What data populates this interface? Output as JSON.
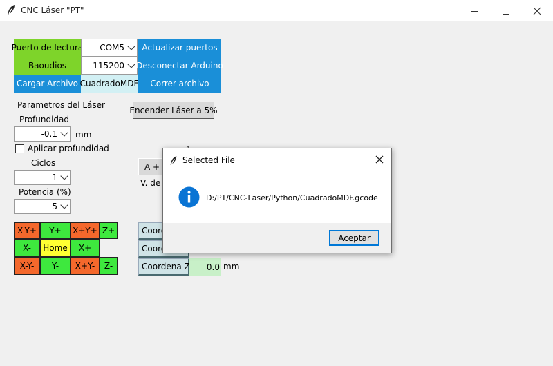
{
  "window": {
    "title": "CNC Láser \"PT\""
  },
  "connection": {
    "port_label": "Puerto de lectura",
    "port_value": "COM5",
    "refresh_ports": "Actualizar puertos",
    "baud_label": "Baoudios",
    "baud_value": "115200",
    "disconnect": "Desconectar Arduino",
    "load_file": "Cargar Archivo",
    "file_name": "CuadradoMDF",
    "run_file": "Correr archivo"
  },
  "laser": {
    "params_heading": "Parametros del Láser",
    "depth_label": "Profundidad",
    "depth_value": "-0.1",
    "depth_unit": "mm",
    "apply_depth_label": "Aplicar profundidad",
    "apply_depth_checked": false,
    "cycles_label": "Ciclos",
    "cycles_value": "1",
    "power_label": "Potencia (%)",
    "power_value": "5",
    "turn_on_button": "Encender Láser a 5%"
  },
  "partial": {
    "a_plus": "A +",
    "v_label": "V. de A",
    "a_heading": "A"
  },
  "jog": {
    "x_minus_y_plus": "X-Y+",
    "y_plus": "Y+",
    "x_plus_y_plus": "X+Y+",
    "z_plus": "Z+",
    "x_minus": "X-",
    "home": "Home",
    "x_plus": "X+",
    "x_minus_y_minus": "X-Y-",
    "y_minus": "Y-",
    "x_plus_y_minus": "X+Y-",
    "z_minus": "Z-"
  },
  "coords": {
    "x_label": "Coorde",
    "y_label": "Coorde",
    "z_label": "Coordena Z",
    "z_value": "0.0",
    "unit": "mm"
  },
  "dialog": {
    "title": "Selected File",
    "message": "D:/PT/CNC-Laser/Python/CuadradoMDF.gcode",
    "ok_button": "Aceptar"
  },
  "colors": {
    "green": "#7ed42a",
    "blue": "#1a8fd8",
    "orange": "#f4682c",
    "light_green": "#3ee83e",
    "yellow": "#ffff33",
    "info_blue": "#0a74d4"
  }
}
